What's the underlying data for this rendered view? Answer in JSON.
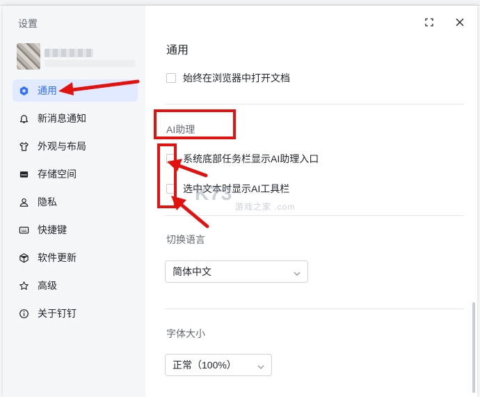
{
  "settings_title": "设置",
  "nav": [
    {
      "label": "通用",
      "icon": "gear-icon",
      "active": true
    },
    {
      "label": "新消息通知",
      "icon": "bell-icon"
    },
    {
      "label": "外观与布局",
      "icon": "shirt-icon"
    },
    {
      "label": "存储空间",
      "icon": "storage-icon"
    },
    {
      "label": "隐私",
      "icon": "person-icon"
    },
    {
      "label": "快捷键",
      "icon": "keyboard-icon"
    },
    {
      "label": "软件更新",
      "icon": "update-icon"
    },
    {
      "label": "高级",
      "icon": "star-icon"
    },
    {
      "label": "关于钉钉",
      "icon": "info-icon"
    }
  ],
  "main": {
    "title": "通用",
    "open_in_browser": "始终在浏览器中打开文档",
    "ai_section_label": "AI助理",
    "ai_taskbar": "系统底部任务栏显示AI助理入口",
    "ai_toolbar": "选中文本时显示AI工具栏",
    "language_label": "切换语言",
    "language_value": "简体中文",
    "font_size_label": "字体大小",
    "font_size_value": "正常（100%）"
  },
  "colors": {
    "accent": "#3370ff",
    "annotation": "#e4120f"
  }
}
